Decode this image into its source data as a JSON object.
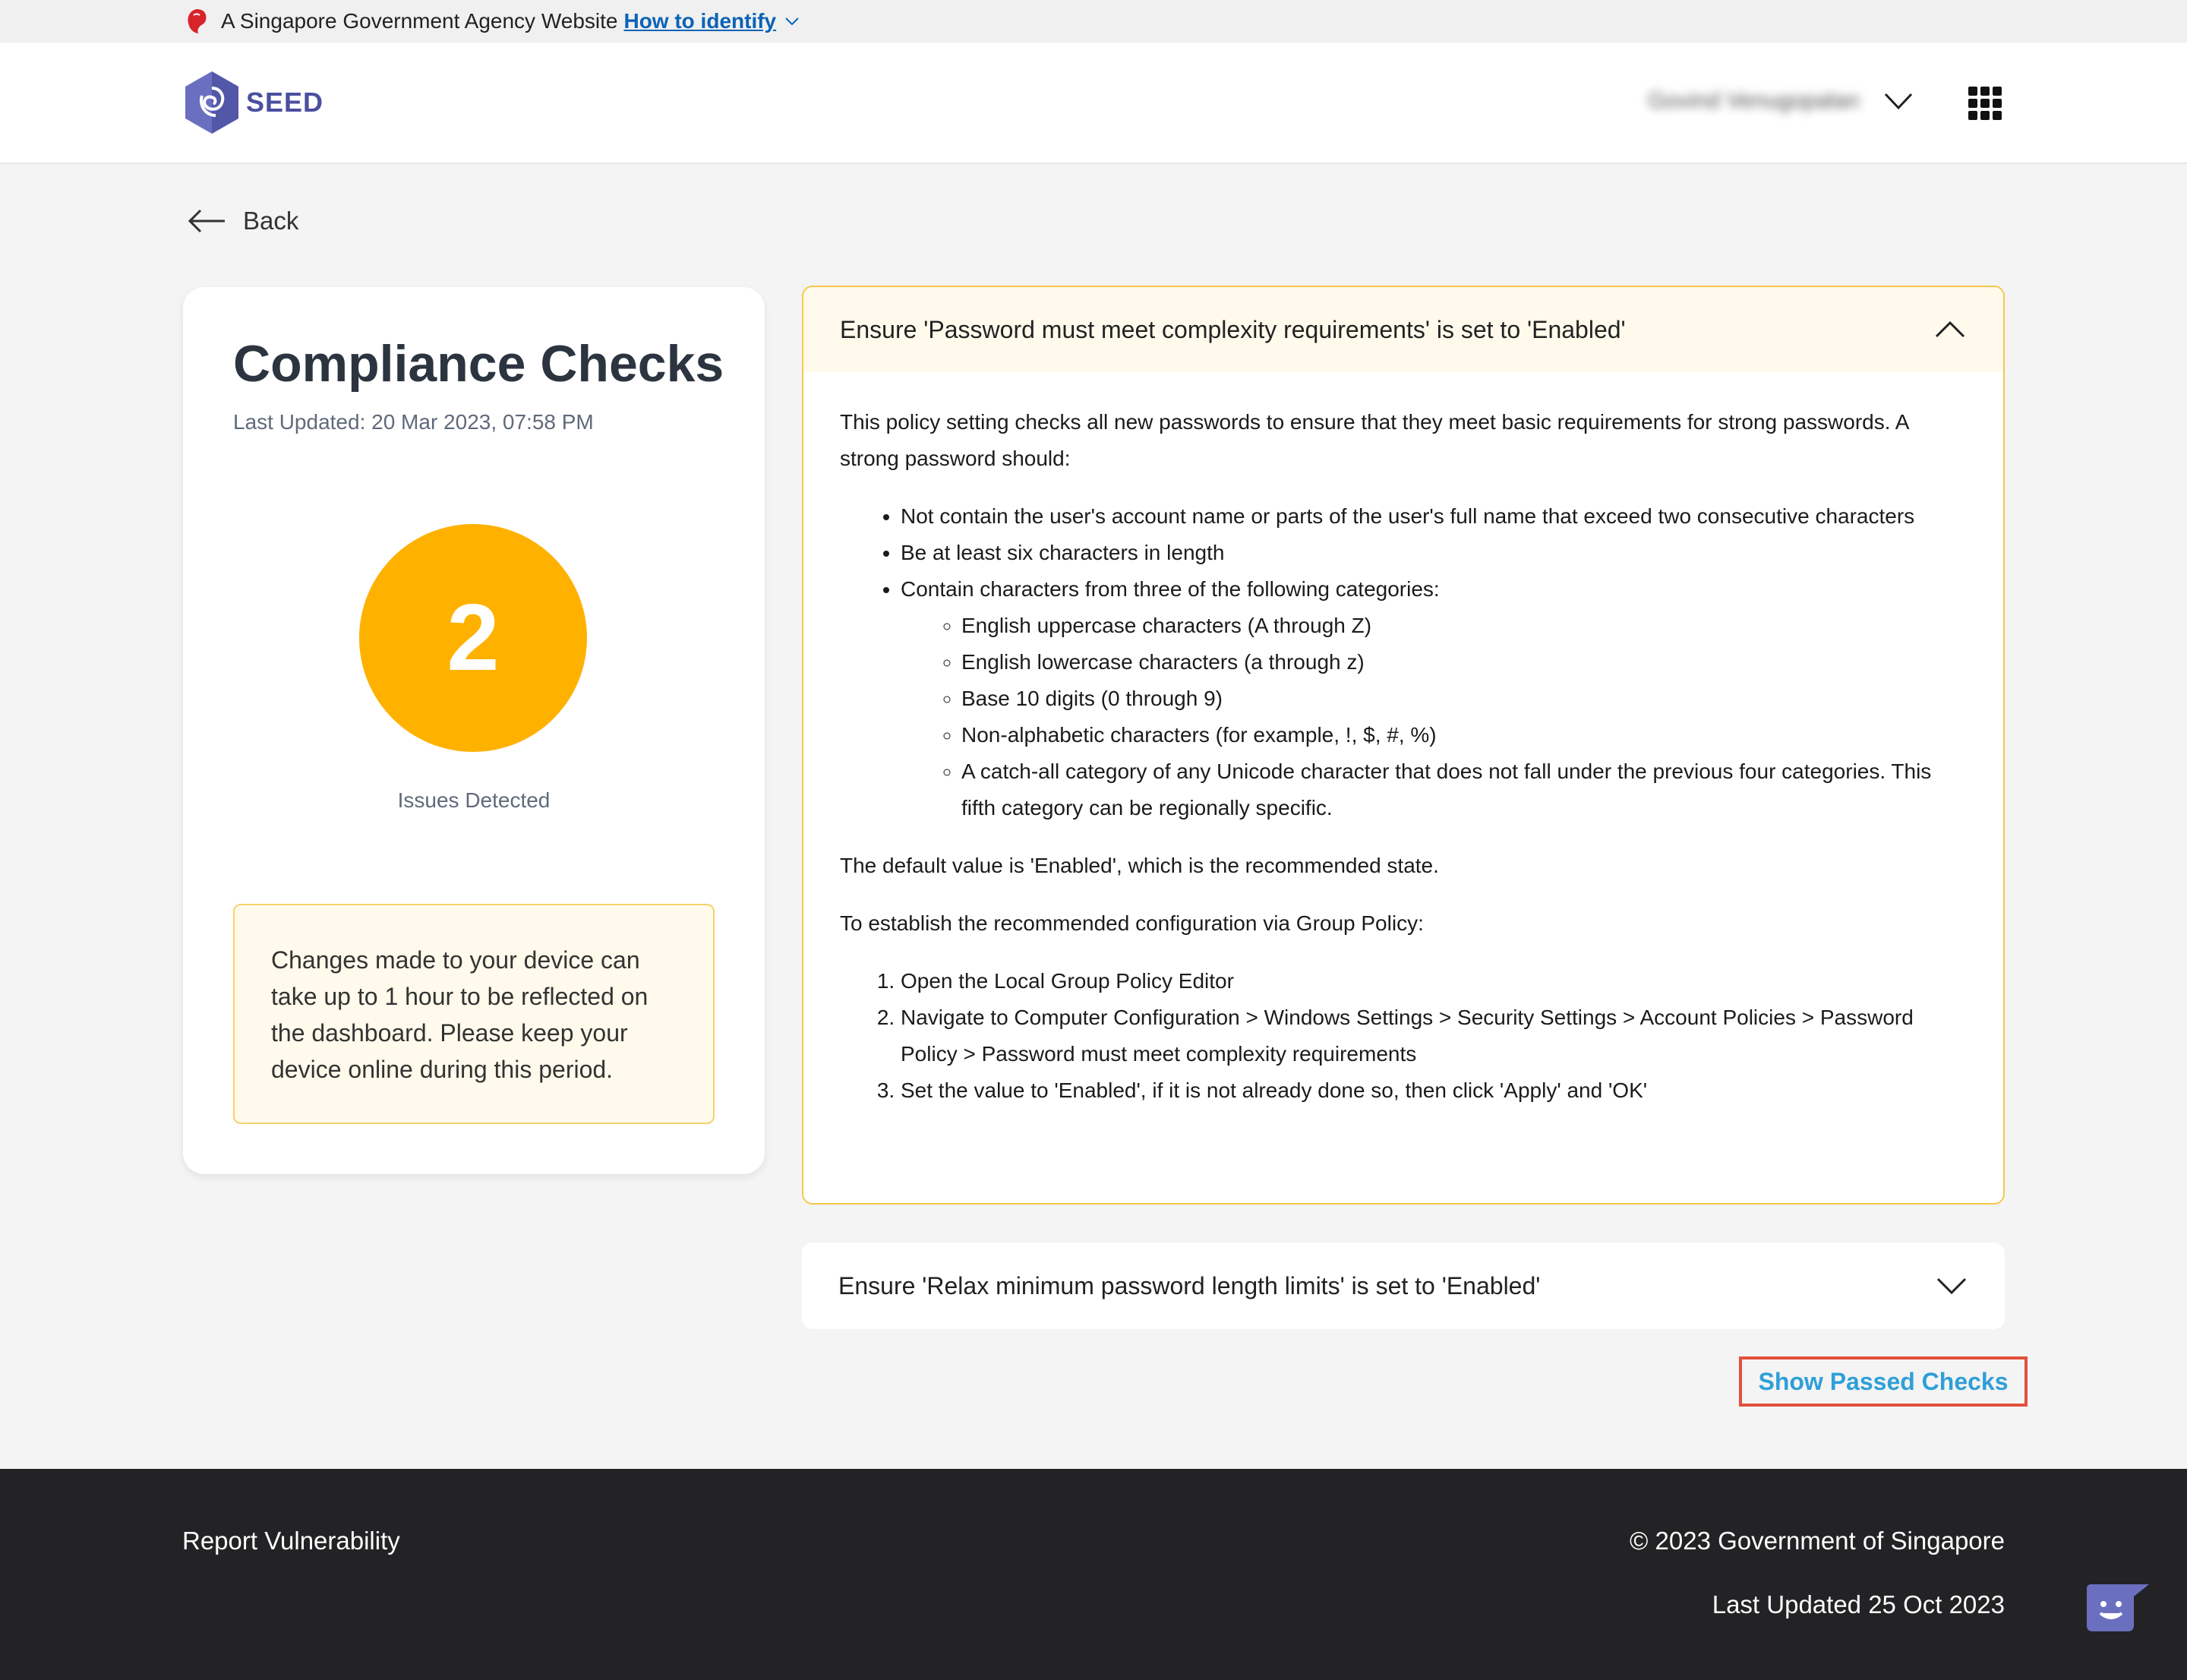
{
  "masthead": {
    "text": "A Singapore Government Agency Website",
    "link": "How to identify",
    "icon": "lion-crest-icon"
  },
  "header": {
    "logo_text": "SEED",
    "user_name": "Govind Venugopalan",
    "user_menu_icon": "chevron-down-icon",
    "apps_icon": "apps-grid-icon"
  },
  "back": {
    "label": "Back",
    "icon": "arrow-left-icon"
  },
  "summary": {
    "title": "Compliance Checks",
    "last_updated": "Last Updated: 20 Mar 2023, 07:58 PM",
    "issues_count": "2",
    "issues_label": "Issues Detected",
    "notice": "Changes made to your device can take up to 1 hour to be reflected on the dashboard. Please keep your device online during this period."
  },
  "checks": [
    {
      "title": "Ensure 'Password must meet complexity requirements' is set to 'Enabled'",
      "expanded": true,
      "intro": "This policy setting checks all new passwords to ensure that they meet basic requirements for strong passwords. A strong password should:",
      "bullets": [
        "Not contain the user's account name or parts of the user's full name that exceed two consecutive characters",
        "Be at least six characters in length",
        "Contain characters from three of the following categories:"
      ],
      "sub_bullets": [
        "English uppercase characters (A through Z)",
        "English lowercase characters (a through z)",
        "Base 10 digits (0 through 9)",
        "Non-alphabetic characters (for example, !, $, #, %)",
        "A catch-all category of any Unicode character that does not fall under the previous four categories. This fifth category can be regionally specific."
      ],
      "default_text": "The default value is 'Enabled', which is the recommended state.",
      "config_intro": "To establish the recommended configuration via Group Policy:",
      "steps": [
        "Open the Local Group Policy Editor",
        "Navigate to Computer Configuration > Windows Settings > Security Settings > Account Policies > Password Policy > Password must meet complexity requirements",
        "Set the value to 'Enabled', if it is not already done so, then click 'Apply' and 'OK'"
      ]
    },
    {
      "title": "Ensure 'Relax minimum password length limits' is set to 'Enabled'",
      "expanded": false
    }
  ],
  "show_passed": "Show Passed Checks",
  "footer": {
    "report": "Report Vulnerability",
    "copyright": "© 2023 Government of Singapore",
    "last_updated": "Last Updated 25 Oct 2023",
    "chat_icon": "chat-bot-icon"
  },
  "colors": {
    "accent_orange": "#ffb100",
    "link_blue": "#2f9fd8",
    "highlight_red": "#e2503d",
    "brand_purple": "#4b4fa0",
    "footer_bg": "#232325"
  }
}
